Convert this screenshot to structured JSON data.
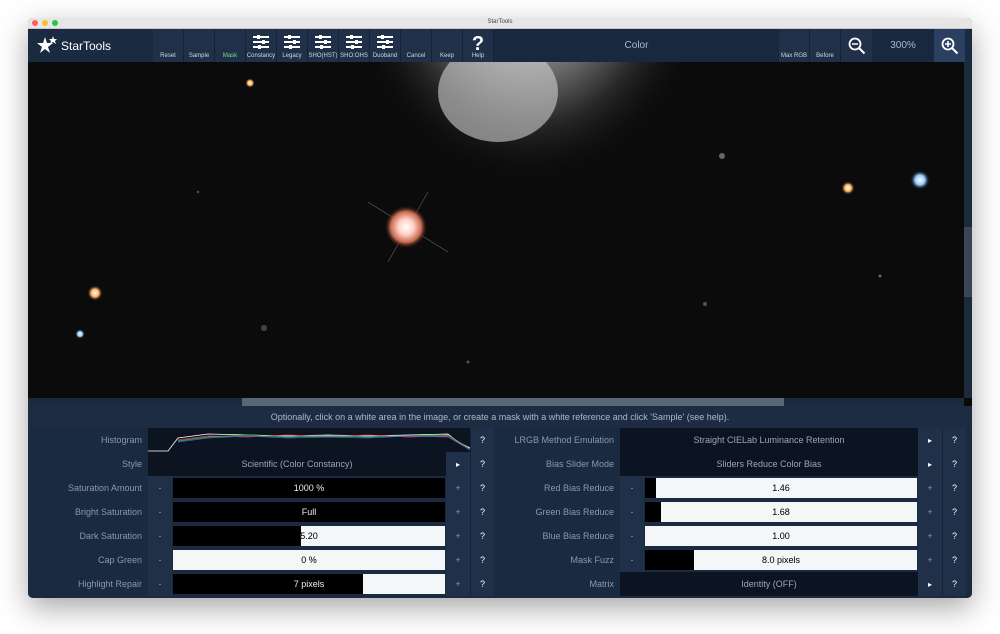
{
  "window": {
    "title": "StarTools"
  },
  "toolbar": {
    "logo": "StarTools",
    "buttons": [
      "Reset",
      "Sample",
      "Mask",
      "Constancy",
      "Legacy",
      "SHO(HST)",
      "SHO:OHS",
      "Duoband",
      "Cancel",
      "Keep",
      "Help"
    ],
    "module_name": "Color",
    "max_rgb": "Max RGB",
    "before": "Before",
    "zoom": "300%"
  },
  "hint": "Optionally, click on a white area in the image, or create a mask with a white reference and click 'Sample' (see help).",
  "left_params": [
    {
      "label": "Histogram",
      "kind": "histogram"
    },
    {
      "label": "Style",
      "kind": "select",
      "value": "Scientific (Color Constancy)"
    },
    {
      "label": "Saturation Amount",
      "kind": "slider",
      "value": "1000 %",
      "fill": 1.0
    },
    {
      "label": "Bright Saturation",
      "kind": "slider",
      "value": "Full",
      "fill": 1.0
    },
    {
      "label": "Dark Saturation",
      "kind": "slider",
      "value": "5.20",
      "fill": 0.47
    },
    {
      "label": "Cap Green",
      "kind": "slider",
      "value": "0 %",
      "fill": 0.0
    },
    {
      "label": "Highlight Repair",
      "kind": "slider",
      "value": "7 pixels",
      "fill": 0.7
    }
  ],
  "right_params": [
    {
      "label": "LRGB Method Emulation",
      "kind": "select",
      "value": "Straight CIELab Luminance Retention"
    },
    {
      "label": "Bias Slider Mode",
      "kind": "select",
      "value": "Sliders Reduce Color Bias"
    },
    {
      "label": "Red Bias Reduce",
      "kind": "slider",
      "value": "1.46",
      "fill": 0.04
    },
    {
      "label": "Green Bias Reduce",
      "kind": "slider",
      "value": "1.68",
      "fill": 0.06
    },
    {
      "label": "Blue Bias Reduce",
      "kind": "slider",
      "value": "1.00",
      "fill": 0.0
    },
    {
      "label": "Mask Fuzz",
      "kind": "slider",
      "value": "8.0 pixels",
      "fill": 0.18
    },
    {
      "label": "Matrix",
      "kind": "select",
      "value": "Identity (OFF)"
    }
  ],
  "colors": {
    "accent_green": "#7de08a",
    "bg": "#1a2a40"
  }
}
